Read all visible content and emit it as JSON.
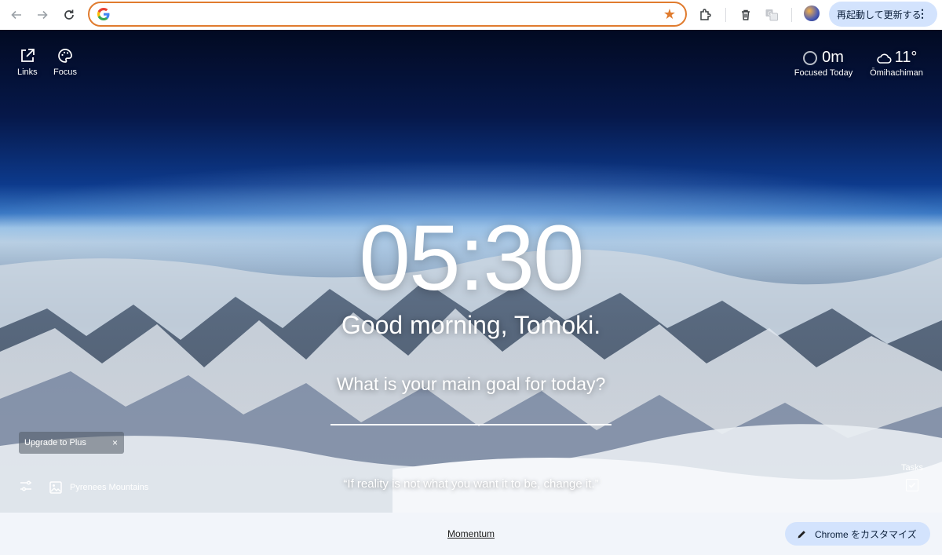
{
  "browser": {
    "omnibox_value": "",
    "restart_button_label": "再起動して更新する",
    "more_icon": "⋮",
    "accent_color": "#e07b2e"
  },
  "momentum": {
    "links_label": "Links",
    "focus_label": "Focus",
    "focused_today_value": "0m",
    "focused_today_label": "Focused Today",
    "temperature": "11°",
    "location": "Ōmihachiman",
    "time": "05:30",
    "greeting": "Good morning, Tomoki.",
    "goal_question": "What is your main goal for today?",
    "goal_value": "",
    "upgrade_label": "Upgrade to Plus",
    "upgrade_close": "×",
    "photo_location": "Pyrenees Mountains",
    "quote": "“If reality is not what you want it to be, change it.”",
    "tasks_label": "Tasks"
  },
  "footer": {
    "extension_link": "Momentum",
    "customize_label": "Chrome をカスタマイズ"
  }
}
